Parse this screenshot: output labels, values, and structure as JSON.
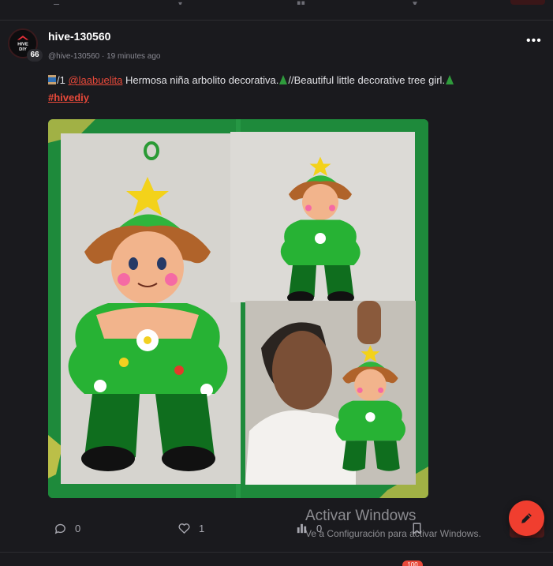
{
  "post": {
    "author": "hive-130560",
    "reputation": "66",
    "handle": "@hive-130560",
    "separator": "·",
    "time": "19 minutes ago",
    "body_prefix": "/1",
    "mention": "@laabuelita",
    "body_text": "Hermosa niña arbolito decorativa.",
    "body_text2": "//Beautiful little decorative tree girl.",
    "hashtag": "#hivediy",
    "avatar_text": "HIVE DIY"
  },
  "actions": {
    "comments": "0",
    "likes": "1",
    "views": "0"
  },
  "notifications": {
    "badge": "100"
  },
  "watermark": {
    "line1": "Activar Windows",
    "line2": "Ve a Configuración para activar Windows."
  },
  "colors": {
    "background": "#1a1a1e",
    "accent": "#e8493a",
    "fab": "#f03e2f",
    "frame_green": "#1f8a3a"
  },
  "icons": {
    "more": "more-horizontal-icon",
    "comment": "comment-icon",
    "like": "heart-icon",
    "views": "bar-chart-icon",
    "bookmark": "bookmark-icon",
    "compose": "pencil-icon"
  }
}
